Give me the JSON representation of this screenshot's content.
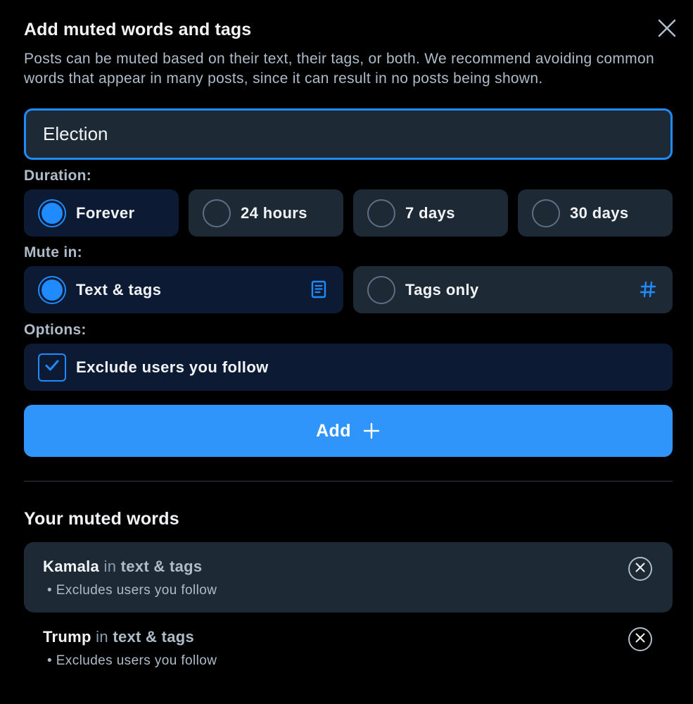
{
  "dialog": {
    "title": "Add muted words and tags",
    "description": "Posts can be muted based on their text, their tags, or both. We recommend avoiding common words that appear in many posts, since it can result in no posts being shown.",
    "close_icon": "close-icon"
  },
  "input": {
    "value": "Election"
  },
  "duration": {
    "label": "Duration:",
    "options": [
      {
        "label": "Forever",
        "selected": true
      },
      {
        "label": "24 hours",
        "selected": false
      },
      {
        "label": "7 days",
        "selected": false
      },
      {
        "label": "30 days",
        "selected": false
      }
    ]
  },
  "mute_in": {
    "label": "Mute in:",
    "options": [
      {
        "label": "Text & tags",
        "selected": true,
        "icon": "document-icon"
      },
      {
        "label": "Tags only",
        "selected": false,
        "icon": "hashtag-icon"
      }
    ]
  },
  "options": {
    "label": "Options:",
    "exclude_following": {
      "label": "Exclude users you follow",
      "checked": true
    }
  },
  "add_button": {
    "label": "Add",
    "icon": "plus-icon"
  },
  "muted_list": {
    "title": "Your muted words",
    "items": [
      {
        "word": "Kamala",
        "in": "in",
        "where": "text & tags",
        "note": "• Excludes users you follow"
      },
      {
        "word": "Trump",
        "in": "in",
        "where": "text & tags",
        "note": "• Excludes users you follow"
      }
    ]
  },
  "colors": {
    "accent": "#208bfe",
    "button": "#2f95fb",
    "background": "#000000",
    "panel": "#1e2936",
    "selected_panel": "#0c1b33"
  }
}
